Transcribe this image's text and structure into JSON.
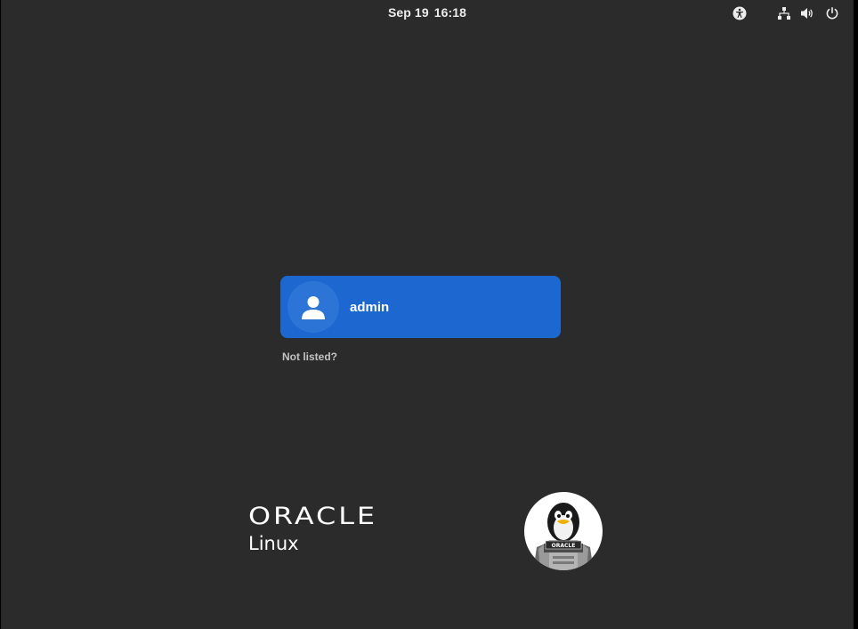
{
  "top_bar": {
    "date": "Sep 19",
    "time": "16:18",
    "icons": {
      "accessibility": "accessibility-icon",
      "network": "network-wired-icon",
      "volume": "volume-icon",
      "power": "power-icon"
    }
  },
  "login": {
    "user": {
      "name": "admin",
      "avatar_icon": "user-avatar-icon"
    },
    "not_listed_label": "Not listed?"
  },
  "branding": {
    "logo_name": "ORACLE",
    "product": "Linux",
    "mascot_badge": "ORACLE"
  },
  "colors": {
    "background": "#2b2b2b",
    "user_card": "#1c68d0",
    "text": "#ffffff",
    "muted_text": "#c2c2c2"
  }
}
